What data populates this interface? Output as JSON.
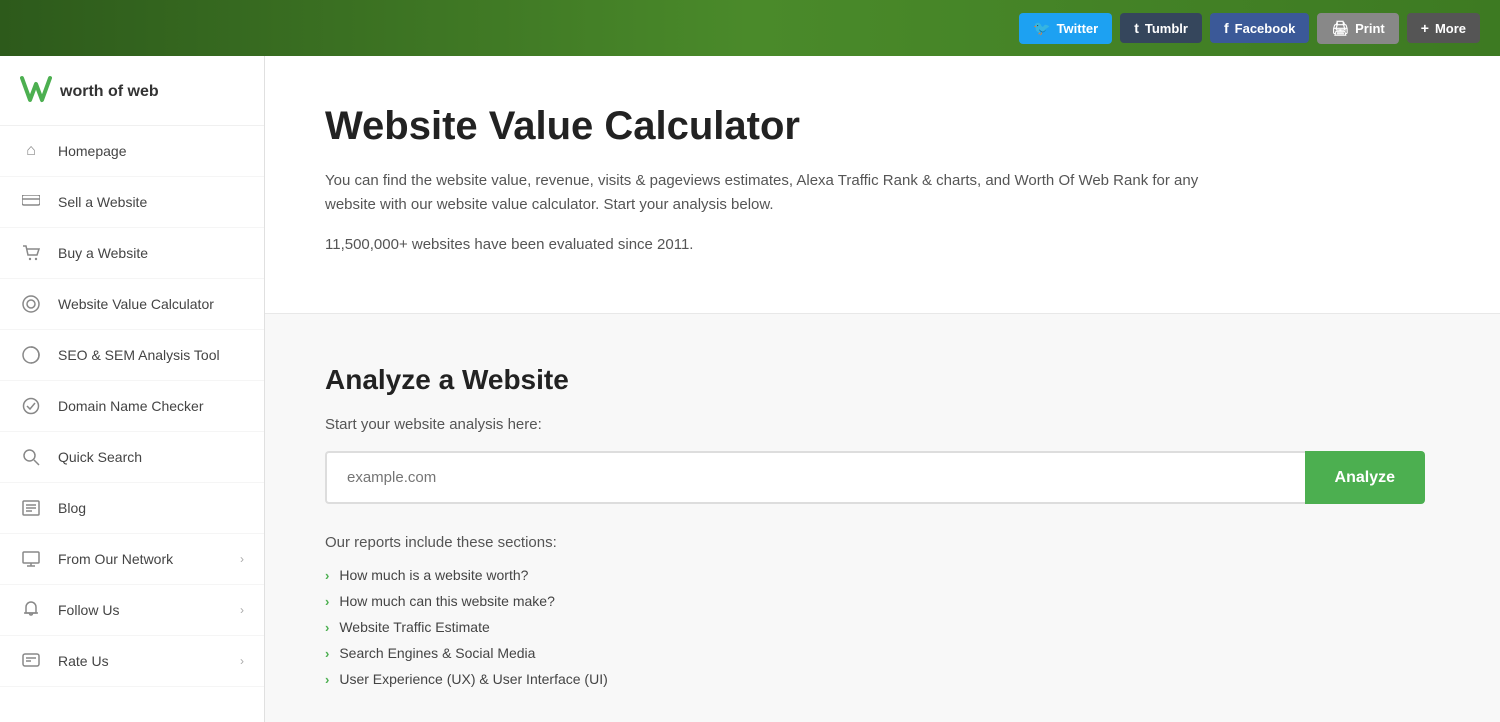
{
  "topbar": {
    "buttons": [
      {
        "id": "twitter",
        "label": "Twitter",
        "icon": "𝕏",
        "class": "btn-twitter"
      },
      {
        "id": "tumblr",
        "label": "Tumblr",
        "icon": "t",
        "class": "btn-tumblr"
      },
      {
        "id": "facebook",
        "label": "Facebook",
        "icon": "f",
        "class": "btn-facebook"
      },
      {
        "id": "print",
        "label": "Print",
        "icon": "🖨",
        "class": "btn-print"
      },
      {
        "id": "more",
        "label": "More",
        "icon": "+",
        "class": "btn-more"
      }
    ]
  },
  "logo": {
    "symbol": "W",
    "name": "worth of web"
  },
  "nav": {
    "items": [
      {
        "id": "homepage",
        "label": "Homepage",
        "icon": "⌂",
        "arrow": false
      },
      {
        "id": "sell-website",
        "label": "Sell a Website",
        "icon": "💵",
        "arrow": false
      },
      {
        "id": "buy-website",
        "label": "Buy a Website",
        "icon": "🛍",
        "arrow": false
      },
      {
        "id": "website-value",
        "label": "Website Value Calculator",
        "icon": "◎",
        "arrow": false
      },
      {
        "id": "seo-sem",
        "label": "SEO & SEM Analysis Tool",
        "icon": "◑",
        "arrow": false
      },
      {
        "id": "domain-checker",
        "label": "Domain Name Checker",
        "icon": "✓",
        "arrow": false
      },
      {
        "id": "quick-search",
        "label": "Quick Search",
        "icon": "🔍",
        "arrow": false
      },
      {
        "id": "blog",
        "label": "Blog",
        "icon": "☰",
        "arrow": false
      },
      {
        "id": "from-network",
        "label": "From Our Network",
        "icon": "🖥",
        "arrow": true
      },
      {
        "id": "follow-us",
        "label": "Follow Us",
        "icon": "🔔",
        "arrow": true
      },
      {
        "id": "rate-us",
        "label": "Rate Us",
        "icon": "💬",
        "arrow": true
      }
    ]
  },
  "hero": {
    "title": "Website Value Calculator",
    "description": "You can find the website value, revenue, visits & pageviews estimates, Alexa Traffic Rank & charts, and Worth Of Web Rank for any website with our website value calculator. Start your analysis below.",
    "count": "11,500,000+ websites have been evaluated since 2011."
  },
  "analyze": {
    "title": "Analyze a Website",
    "sublabel": "Start your website analysis here:",
    "placeholder": "example.com",
    "button_label": "Analyze",
    "reports_label": "Our reports include these sections:",
    "report_items": [
      "How much is a website worth?",
      "How much can this website make?",
      "Website Traffic Estimate",
      "Search Engines & Social Media",
      "User Experience (UX) & User Interface (UI)"
    ]
  },
  "colors": {
    "green": "#4CAF50",
    "dark_green_gradient_start": "#2d5a1b",
    "dark_green_gradient_end": "#4a8a2a"
  }
}
